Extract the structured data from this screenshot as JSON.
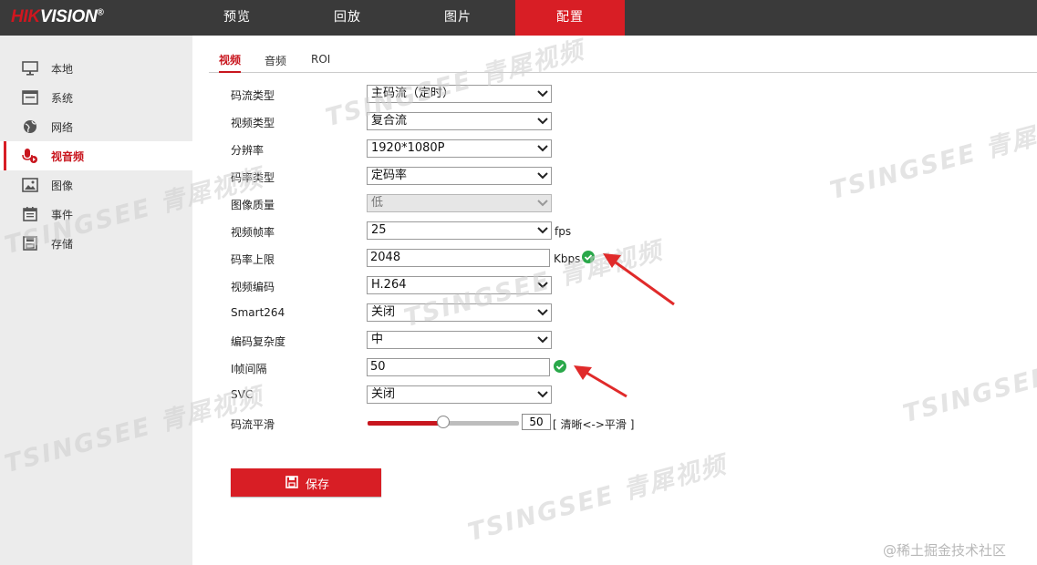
{
  "brand": {
    "logo_red": "HIK",
    "logo_white": "VISION",
    "trademark": "®"
  },
  "nav": [
    {
      "label": "预览"
    },
    {
      "label": "回放"
    },
    {
      "label": "图片"
    },
    {
      "label": "配置",
      "active": true
    }
  ],
  "sidebar": [
    {
      "label": "本地",
      "icon": "monitor-icon"
    },
    {
      "label": "系统",
      "icon": "system-icon"
    },
    {
      "label": "网络",
      "icon": "globe-icon"
    },
    {
      "label": "视音频",
      "icon": "microphone-icon",
      "active": true
    },
    {
      "label": "图像",
      "icon": "image-icon"
    },
    {
      "label": "事件",
      "icon": "event-icon"
    },
    {
      "label": "存储",
      "icon": "storage-icon"
    }
  ],
  "tabs": [
    {
      "label": "视频",
      "active": true
    },
    {
      "label": "音频"
    },
    {
      "label": "ROI"
    }
  ],
  "form": {
    "stream_type": {
      "label": "码流类型",
      "value": "主码流（定时）"
    },
    "video_type": {
      "label": "视频类型",
      "value": "复合流"
    },
    "resolution": {
      "label": "分辨率",
      "value": "1920*1080P"
    },
    "bitrate_type": {
      "label": "码率类型",
      "value": "定码率"
    },
    "image_quality": {
      "label": "图像质量",
      "value": "低",
      "disabled": true
    },
    "frame_rate": {
      "label": "视频帧率",
      "value": "25",
      "unit": "fps"
    },
    "max_bitrate": {
      "label": "码率上限",
      "value": "2048",
      "unit": "Kbps",
      "valid": true
    },
    "video_encoding": {
      "label": "视频编码",
      "value": "H.264"
    },
    "smart264": {
      "label": "Smart264",
      "value": "关闭"
    },
    "encoding_complexity": {
      "label": "编码复杂度",
      "value": "中"
    },
    "i_frame_interval": {
      "label": "I帧间隔",
      "value": "50",
      "valid": true
    },
    "svc": {
      "label": "SVC",
      "value": "关闭"
    },
    "stream_smoothing": {
      "label": "码流平滑",
      "value": "50",
      "hint": "[ 清晰<->平滑 ]",
      "level_percent": 50
    }
  },
  "save_label": "保存",
  "watermarks": [
    "TSINGSEE 青犀视频"
  ],
  "footer_watermark": "@稀土掘金技术社区",
  "colors": {
    "accent": "#d81e25",
    "topbar": "#3a3a3a",
    "sidebar": "#ececec",
    "valid": "#2aa84a"
  }
}
